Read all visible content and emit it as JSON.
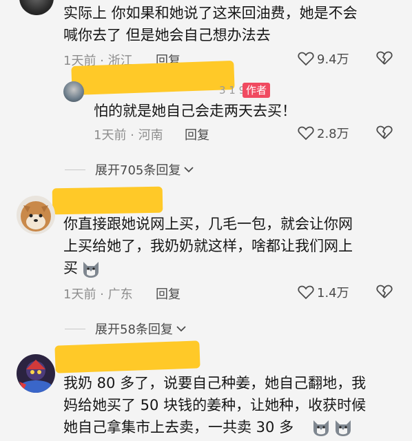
{
  "comments": [
    {
      "text_line1": "实际上 你如果和她说了这来回油费，她是不会",
      "text_line2": "喊你去了 但是她会自己想办法去",
      "time": "1天前 · 浙江",
      "reply_label": "回复",
      "likes": "9.4万"
    },
    {
      "username_fragment": "3 1 9",
      "author_badge": "作者",
      "text_line1": "怕的就是她自己会走两天去买！",
      "time": "1天前 · 河南",
      "reply_label": "回复",
      "likes": "2.8万"
    },
    {
      "expand_label": "展开705条回复"
    },
    {
      "text_line1": "你直接跟她说网上买，几毛一包，就会让你网",
      "text_line2": "上买给她了，我奶奶就这样，啥都让我们网上",
      "text_line3": "买",
      "time": "1天前 · 广东",
      "reply_label": "回复",
      "likes": "1.4万"
    },
    {
      "expand_label": "展开58条回复"
    },
    {
      "text_line1": "我奶 80 多了，说要自己种姜，她自己翻地，我",
      "text_line2": "妈给她买了 50 块钱的姜种，让她种，收获时候",
      "text_line3": "她自己拿集市上去卖，一共卖 30 多"
    }
  ],
  "icons": {
    "like": "heart-outline-icon",
    "dislike": "broken-heart-icon",
    "expand": "chevron-down-icon",
    "emoji": "husky-emoji-icon"
  }
}
